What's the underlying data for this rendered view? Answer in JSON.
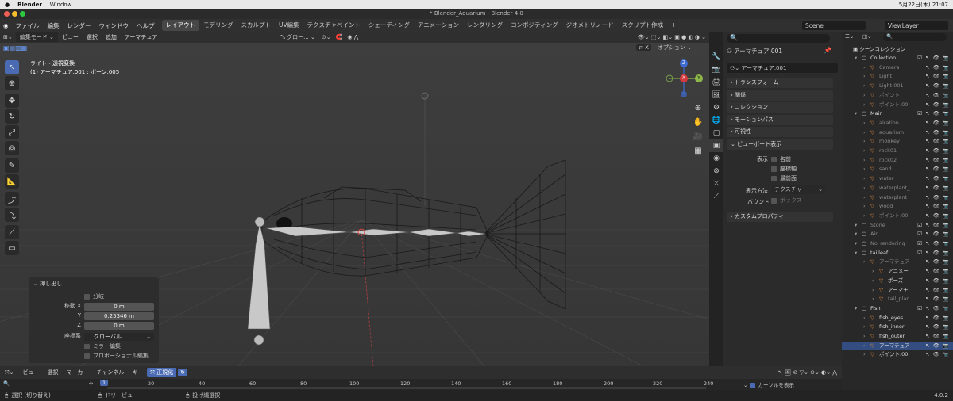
{
  "macbar": {
    "app": "Blender",
    "menu": "Window",
    "datetime": "5月22日(木) 21:07"
  },
  "window_title": "* Blender_Aquarium - Blender 4.0",
  "topbar": {
    "menus": [
      "ファイル",
      "編集",
      "レンダー",
      "ウィンドウ",
      "ヘルプ"
    ],
    "workspaces": [
      "レイアウト",
      "モデリング",
      "スカルプト",
      "UV編集",
      "テクスチャペイント",
      "シェーディング",
      "アニメーション",
      "レンダリング",
      "コンポジティング",
      "ジオメトリノード",
      "スクリプト作成"
    ],
    "active_workspace": "レイアウト",
    "scene": "Scene",
    "view_layer": "ViewLayer"
  },
  "viewport": {
    "mode": "編集モード",
    "menus": [
      "ビュー",
      "選択",
      "追加",
      "アーマチュア"
    ],
    "orientation": "グロー...",
    "info_line1": "ライト・透視変換",
    "info_line2": "(1) アーマチュア.001 : ボーン.005",
    "options_label": "オプション",
    "x_label": "X",
    "gizmo": {
      "z": "Z",
      "x": "X",
      "y": "Y"
    }
  },
  "operator_panel": {
    "title": "押し出し",
    "split_label": "分岐",
    "move_x_label": "移動 X",
    "move_x": "0 m",
    "y_label": "Y",
    "y": "0.25346 m",
    "z_label": "Z",
    "z": "0 m",
    "coord_label": "座標系",
    "coord": "グローバル",
    "mirror_label": "ミラー編集",
    "proportional_label": "プロポーショナル編集"
  },
  "timeline": {
    "menus": [
      "ビュー",
      "選択",
      "マーカー",
      "チャンネル",
      "キー"
    ],
    "normalize": "正規化",
    "current_frame": "1",
    "ticks": [
      "20",
      "40",
      "60",
      "80",
      "100",
      "120",
      "140",
      "160",
      "180",
      "200",
      "220",
      "240"
    ],
    "show_cursor": "カーソルを表示"
  },
  "status": {
    "select": "選択 (切り替え)",
    "dolly": "ドリービュー",
    "lasso": "投げ縄選択",
    "version": "4.0.2"
  },
  "properties": {
    "object_name": "アーマチュア.001",
    "data_name": "アーマチュア.001",
    "sections": [
      "トランスフォーム",
      "関係",
      "コレクション",
      "モーションパス",
      "可視性"
    ],
    "viewport_display": "ビューポート表示",
    "show_label": "表示",
    "checks": [
      "名前",
      "座標軸",
      "最前面"
    ],
    "display_as_label": "表示方法",
    "display_as": "テクスチャ",
    "bounds_label": "バウンド",
    "bounds": "ボックス",
    "custom_props": "カスタムプロパティ"
  },
  "outliner": {
    "header": "シーンコレクション",
    "rows": [
      {
        "label": "Collection",
        "indent": 1,
        "type": "coll"
      },
      {
        "label": "Camera",
        "indent": 2,
        "type": "obj",
        "dim": true
      },
      {
        "label": "Light",
        "indent": 2,
        "type": "obj",
        "dim": true
      },
      {
        "label": "Light.001",
        "indent": 2,
        "type": "obj",
        "dim": true
      },
      {
        "label": "ポイント",
        "indent": 2,
        "type": "obj",
        "dim": true
      },
      {
        "label": "ポイント.00",
        "indent": 2,
        "type": "obj",
        "dim": true
      },
      {
        "label": "Main",
        "indent": 1,
        "type": "coll"
      },
      {
        "label": "airation",
        "indent": 2,
        "type": "obj",
        "dim": true
      },
      {
        "label": "aquarium",
        "indent": 2,
        "type": "obj",
        "dim": true
      },
      {
        "label": "monkey",
        "indent": 2,
        "type": "obj",
        "dim": true
      },
      {
        "label": "rock01",
        "indent": 2,
        "type": "obj",
        "dim": true
      },
      {
        "label": "rock02",
        "indent": 2,
        "type": "obj",
        "dim": true
      },
      {
        "label": "sand",
        "indent": 2,
        "type": "obj",
        "dim": true
      },
      {
        "label": "water",
        "indent": 2,
        "type": "obj",
        "dim": true
      },
      {
        "label": "waterplant_",
        "indent": 2,
        "type": "obj",
        "dim": true
      },
      {
        "label": "waterplant_",
        "indent": 2,
        "type": "obj",
        "dim": true
      },
      {
        "label": "wood",
        "indent": 2,
        "type": "obj",
        "dim": true
      },
      {
        "label": "ポイント.00",
        "indent": 2,
        "type": "obj",
        "dim": true
      },
      {
        "label": "Stone",
        "indent": 1,
        "type": "coll",
        "dim": true
      },
      {
        "label": "Air",
        "indent": 1,
        "type": "coll",
        "dim": true
      },
      {
        "label": "No_rendering",
        "indent": 1,
        "type": "coll",
        "dim": true
      },
      {
        "label": "tailleaf",
        "indent": 1,
        "type": "coll"
      },
      {
        "label": "アーマチュア",
        "indent": 2,
        "type": "obj",
        "dim": true
      },
      {
        "label": "アニメー",
        "indent": 3,
        "type": "obj"
      },
      {
        "label": "ポーズ",
        "indent": 3,
        "type": "obj"
      },
      {
        "label": "アーマチ",
        "indent": 3,
        "type": "obj"
      },
      {
        "label": "tail_plan",
        "indent": 3,
        "type": "obj",
        "dim": true
      },
      {
        "label": "Fish",
        "indent": 1,
        "type": "coll"
      },
      {
        "label": "fish_eyes",
        "indent": 2,
        "type": "obj"
      },
      {
        "label": "fish_inner",
        "indent": 2,
        "type": "obj"
      },
      {
        "label": "fish_outer",
        "indent": 2,
        "type": "obj"
      },
      {
        "label": "アーマチュア",
        "indent": 2,
        "type": "obj",
        "selected": true
      },
      {
        "label": "ポイント.00",
        "indent": 2,
        "type": "obj"
      }
    ]
  }
}
